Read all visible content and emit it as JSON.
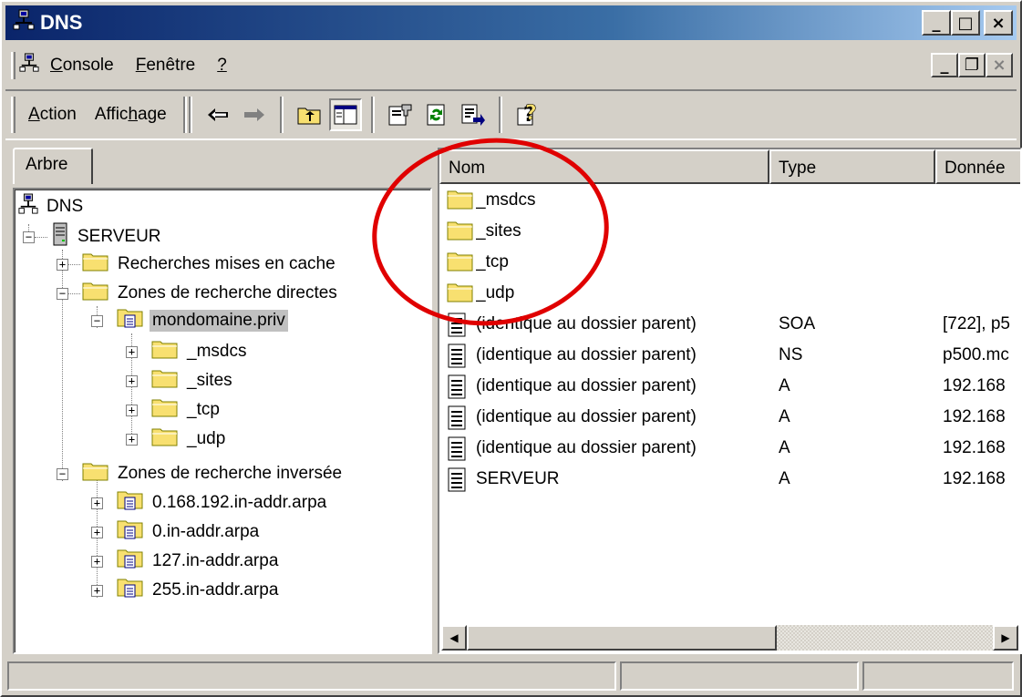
{
  "window": {
    "title": "DNS",
    "buttons": {
      "minimize": "_",
      "maximize": "□",
      "close": "×"
    }
  },
  "menubar": {
    "items": [
      {
        "label": "Console",
        "underline": "C",
        "rest": "onsole"
      },
      {
        "label": "Fenêtre",
        "underline": "F",
        "rest": "enêtre"
      },
      {
        "label": "?",
        "underline": "?",
        "rest": ""
      }
    ]
  },
  "toolbar": {
    "action": {
      "underline": "A",
      "rest": "ction"
    },
    "affichage": {
      "pre": "Affic",
      "underline": "h",
      "rest": "age"
    },
    "icons": [
      "back-arrow-icon",
      "forward-arrow-icon",
      "up-folder-icon",
      "show-hide-tree-icon",
      "properties-icon",
      "refresh-icon",
      "export-list-icon",
      "help-icon"
    ]
  },
  "left_pane": {
    "tab_label": "Arbre",
    "tree": [
      {
        "label": "DNS"
      },
      {
        "label": "SERVEUR"
      },
      {
        "label": "Recherches mises en cache"
      },
      {
        "label": "Zones de recherche directes"
      },
      {
        "label": "mondomaine.priv"
      },
      {
        "label": "_msdcs"
      },
      {
        "label": "_sites"
      },
      {
        "label": "_tcp"
      },
      {
        "label": "_udp"
      },
      {
        "label": "Zones de recherche inversée"
      },
      {
        "label": "0.168.192.in-addr.arpa"
      },
      {
        "label": "0.in-addr.arpa"
      },
      {
        "label": "127.in-addr.arpa"
      },
      {
        "label": "255.in-addr.arpa"
      }
    ]
  },
  "right_pane": {
    "columns": [
      "Nom",
      "Type",
      "Donnée"
    ],
    "rows": [
      {
        "name": "_msdcs",
        "type": "",
        "data": "",
        "icon": "folder-icon"
      },
      {
        "name": "_sites",
        "type": "",
        "data": "",
        "icon": "folder-icon"
      },
      {
        "name": "_tcp",
        "type": "",
        "data": "",
        "icon": "folder-icon"
      },
      {
        "name": "_udp",
        "type": "",
        "data": "",
        "icon": "folder-icon"
      },
      {
        "name": "(identique au dossier parent)",
        "type": "SOA",
        "data": "[722], p5",
        "icon": "record-icon"
      },
      {
        "name": "(identique au dossier parent)",
        "type": "NS",
        "data": "p500.mc",
        "icon": "record-icon"
      },
      {
        "name": "(identique au dossier parent)",
        "type": "A",
        "data": "192.168",
        "icon": "record-icon"
      },
      {
        "name": "(identique au dossier parent)",
        "type": "A",
        "data": "192.168",
        "icon": "record-icon"
      },
      {
        "name": "(identique au dossier parent)",
        "type": "A",
        "data": "192.168",
        "icon": "record-icon"
      },
      {
        "name": "SERVEUR",
        "type": "A",
        "data": "192.168",
        "icon": "record-icon"
      }
    ]
  },
  "colors": {
    "annotation": "#e00000",
    "titlebar": "#0a246a",
    "folder": "#f8e070"
  }
}
